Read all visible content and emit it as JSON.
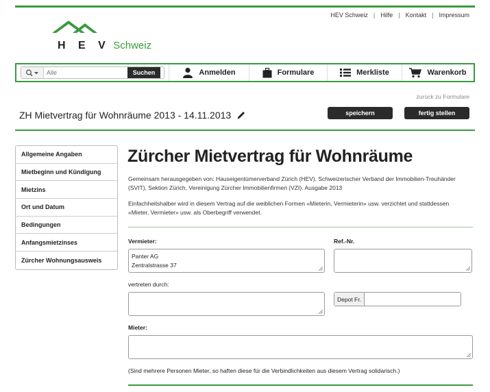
{
  "header": {
    "links": [
      "HEV Schweiz",
      "Hilfe",
      "Kontakt",
      "Impressum"
    ],
    "logo_text": "H E V",
    "logo_sub": "Schweiz"
  },
  "navbar": {
    "search_placeholder": "Alle",
    "search_button": "Suchen",
    "items": [
      {
        "label": "Anmelden",
        "icon": "user-icon"
      },
      {
        "label": "Formulare",
        "icon": "briefcase-icon"
      },
      {
        "label": "Merkliste",
        "icon": "list-icon"
      },
      {
        "label": "Warenkorb",
        "icon": "cart-icon"
      }
    ]
  },
  "toolbar": {
    "back_link": "zurück zu Formulare",
    "doc_title": "ZH Mietvertrag für Wohnräume 2013 - 14.11.2013",
    "save_button": "speichern",
    "finish_button": "fertig stellen"
  },
  "sidebar": {
    "items": [
      "Allgemeine Angaben",
      "Mietbeginn und Kündigung",
      "Mietzins",
      "Ort und Datum",
      "Bedingungen",
      "Anfangsmietzinses",
      "Zürcher Wohnungsausweis"
    ]
  },
  "main": {
    "title": "Zürcher Mietvertrag für Wohnräume",
    "intro1": "Gemeinsam herausgegeben von: Hauseigentümerverband Zürich (HEV), Schweizerischer Verband der Immobilien-Treuhänder (SVIT), Sektion Zürich, Vereinigung Zürcher Immobilienfirmen (VZI). Ausgabe 2013",
    "intro2": "Einfachheitshalber wird in diesem Vertrag auf die weiblichen Formen «Mieterin, Vermieterin» usw. verzichtet und stattdessen «Mieter, Vermieter» usw. als Oberbegriff verwendet.",
    "vermieter_label": "Vermieter:",
    "vermieter_line1": "Panter AG",
    "vermieter_line2": "Zentralstrasse 37",
    "refnr_label": "Ref.-Nr.",
    "vertreten_label": "vertreten durch:",
    "depot_label": "Depot Fr.",
    "mieter_label": "Mieter:",
    "note": "(Sind mehrere Personen Mieter, so haften diese für die Verbindlichkeiten aus diesem Vertrag solidarisch.)"
  },
  "colors": {
    "accent": "#3a9a3e",
    "dark_button": "#2b2b2b"
  }
}
